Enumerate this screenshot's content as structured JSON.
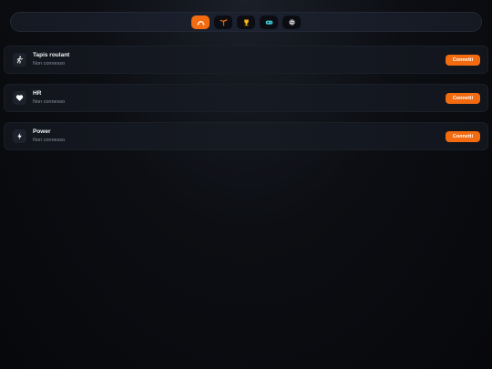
{
  "nav": {
    "tabs": [
      {
        "icon": "route-icon",
        "active": true
      },
      {
        "icon": "tennis-icon",
        "active": false
      },
      {
        "icon": "trophy-icon",
        "active": false
      },
      {
        "icon": "gamepad-icon",
        "active": false
      },
      {
        "icon": "gear-icon",
        "active": false
      }
    ],
    "accent_color": "#f26b10"
  },
  "devices": [
    {
      "icon": "running-icon",
      "name": "Tapis roulant",
      "status": "Non connesso",
      "button_label": "Connetti"
    },
    {
      "icon": "heart-icon",
      "name": "HR",
      "status": "Non connesso",
      "button_label": "Connetti"
    },
    {
      "icon": "bolt-icon",
      "name": "Power",
      "status": "Non connesso",
      "button_label": "Connetti"
    }
  ]
}
